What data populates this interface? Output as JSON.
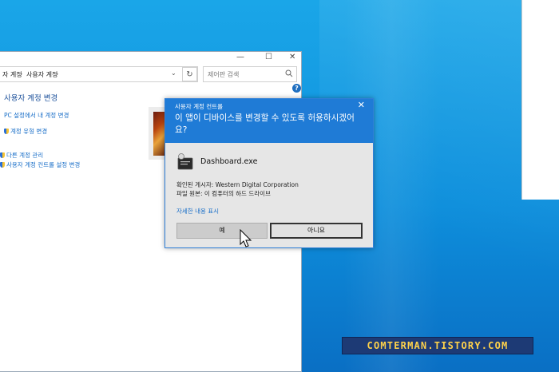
{
  "control_panel": {
    "window_controls": {
      "minimize": "—",
      "maximize": "☐",
      "close": "✕"
    },
    "breadcrumb": [
      "자 계정",
      "사용자 계정"
    ],
    "breadcrumb_separator": "›",
    "address_dropdown": "⌄",
    "refresh": "↻",
    "search_placeholder": "제어판 검색",
    "help": "?",
    "title": "사용자 계정 변경",
    "links": [
      "PC 설정에서 내 계정 변경",
      "계정 유형 변경",
      "다른 계정 관리",
      "사용자 계정 컨트롤 설정 변경"
    ]
  },
  "uac": {
    "header_title": "사용자 계정 컨트롤",
    "close": "✕",
    "question": "이 앱이 디바이스를 변경할 수 있도록 허용하시겠어요?",
    "app_name": "Dashboard.exe",
    "publisher": "확인된 게시자: Western Digital Corporation",
    "file_origin": "파일 원본: 이 컴퓨터의 하드 드라이브",
    "details_link": "자세한 내용 표시",
    "yes_button": "예",
    "no_button": "아니요",
    "header_color": "#1f7bd6"
  },
  "watermark": "COMTERMAN.TISTORY.COM",
  "desktop_color": "#1aa6e8"
}
